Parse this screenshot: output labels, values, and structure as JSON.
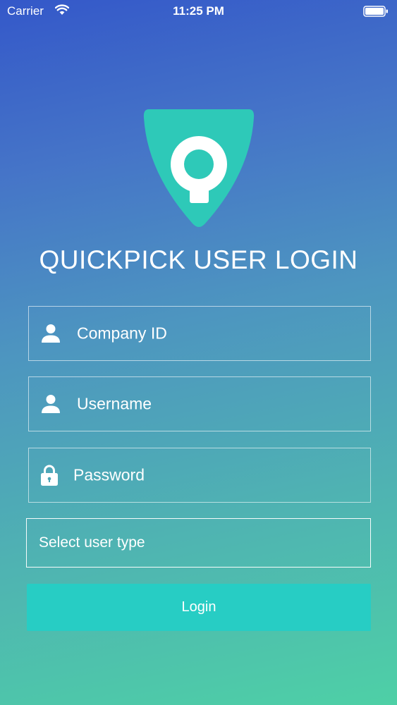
{
  "status_bar": {
    "carrier": "Carrier",
    "time": "11:25 PM"
  },
  "title": "QUICKPICK USER LOGIN",
  "fields": {
    "company_id": {
      "placeholder": "Company ID",
      "icon": "user-icon"
    },
    "username": {
      "placeholder": "Username",
      "icon": "user-icon"
    },
    "password": {
      "placeholder": "Password",
      "icon": "lock-icon"
    }
  },
  "user_type_select": {
    "placeholder": "Select user type"
  },
  "login_button": {
    "label": "Login"
  },
  "colors": {
    "logo_background": "#2ec9b8",
    "button": "#27cdc4",
    "gradient_top": "#3458c9",
    "gradient_bottom": "#4ed0a6"
  }
}
